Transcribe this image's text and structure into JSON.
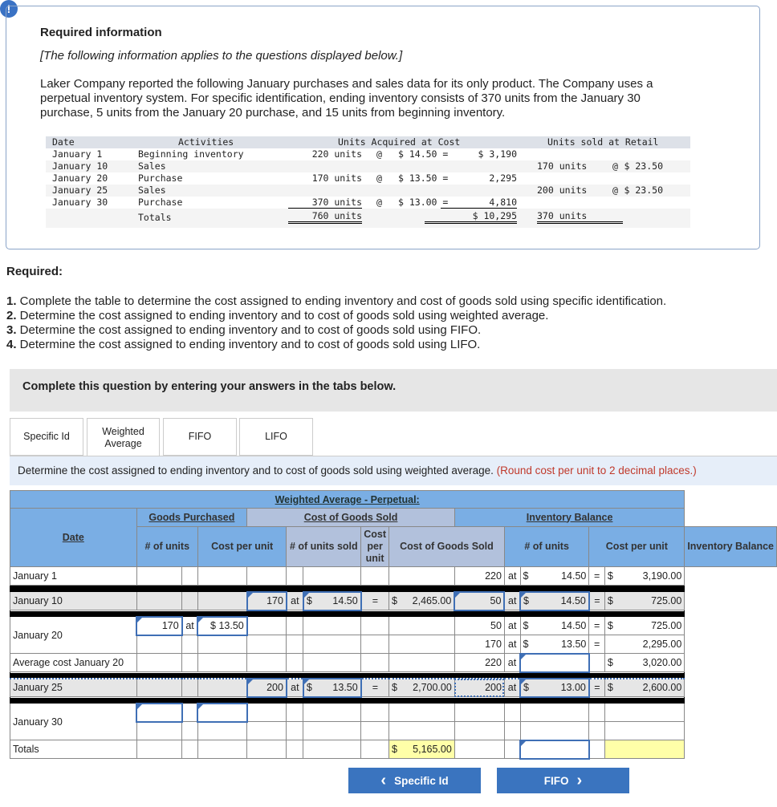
{
  "alert_icon": "!",
  "info": {
    "title": "Required information",
    "subtitle": "[The following information applies to the questions displayed below.]",
    "intro": "Laker Company reported the following January purchases and sales data for its only product. The Company uses a perpetual inventory system. For specific identification, ending inventory consists of 370 units from the January 30 purchase, 5 units from the January 20 purchase, and 15 units from beginning inventory.",
    "table": {
      "headers": {
        "date": "Date",
        "activities": "Activities",
        "acquired": "Units Acquired at Cost",
        "sold": "Units sold at Retail"
      },
      "rows": [
        {
          "date": "January 1",
          "activity": "Beginning inventory",
          "acq_units": "220 units",
          "acq_at": "@",
          "acq_cost": "$ 14.50 =",
          "acq_total": "$ 3,190",
          "sold_units": "",
          "sold_at": "",
          "sold_price": ""
        },
        {
          "date": "January 10",
          "activity": "Sales",
          "acq_units": "",
          "acq_at": "",
          "acq_cost": "",
          "acq_total": "",
          "sold_units": "170 units",
          "sold_at": "@",
          "sold_price": "$ 23.50"
        },
        {
          "date": "January 20",
          "activity": "Purchase",
          "acq_units": "170 units",
          "acq_at": "@",
          "acq_cost": "$ 13.50 =",
          "acq_total": "2,295",
          "sold_units": "",
          "sold_at": "",
          "sold_price": ""
        },
        {
          "date": "January 25",
          "activity": "Sales",
          "acq_units": "",
          "acq_at": "",
          "acq_cost": "",
          "acq_total": "",
          "sold_units": "200 units",
          "sold_at": "@",
          "sold_price": "$ 23.50"
        },
        {
          "date": "January 30",
          "activity": "Purchase",
          "acq_units": "370 units",
          "acq_at": "@",
          "acq_cost": "$ 13.00 =",
          "acq_total": "4,810",
          "sold_units": "",
          "sold_at": "",
          "sold_price": ""
        }
      ],
      "totals": {
        "label": "Totals",
        "acq_units": "760 units",
        "acq_total": "$ 10,295",
        "sold_units": "370 units"
      }
    }
  },
  "required": {
    "title": "Required:",
    "items": [
      {
        "num": "1.",
        "text": " Complete the table to determine the cost assigned to ending inventory and cost of goods sold using specific identification."
      },
      {
        "num": "2.",
        "text": " Determine the cost assigned to ending inventory and to cost of goods sold using weighted average."
      },
      {
        "num": "3.",
        "text": " Determine the cost assigned to ending inventory and to cost of goods sold using FIFO."
      },
      {
        "num": "4.",
        "text": " Determine the cost assigned to ending inventory and to cost of goods sold using LIFO."
      }
    ]
  },
  "band_text": "Complete this question by entering your answers in the tabs below.",
  "tabs": [
    {
      "label": "Specific Id"
    },
    {
      "label": "Weighted Average",
      "active": true
    },
    {
      "label": "FIFO"
    },
    {
      "label": "LIFO"
    }
  ],
  "instruction": {
    "text": "Determine the cost assigned to ending inventory and to cost of goods sold using weighted average. ",
    "note": "(Round cost per unit to 2 decimal places.)"
  },
  "worksheet": {
    "title": "Weighted Average - Perpetual:",
    "groups": {
      "purchased": "Goods Purchased",
      "cogs": "Cost of Goods Sold",
      "inventory": "Inventory Balance"
    },
    "columns": {
      "date": "Date",
      "gp_units": "# of units",
      "gp_cost": "Cost per unit",
      "sold_units": "# of units sold",
      "sold_cost": "Cost per unit",
      "cogs": "Cost of Goods Sold",
      "inv_units": "# of units",
      "inv_cost": "Cost per unit",
      "inv_bal": "Inventory Balance"
    },
    "at_label": "at",
    "eq_label": "=",
    "rows": [
      {
        "date": "January 1",
        "inv_units": "220",
        "inv_cost": "$ 14.50",
        "inv_bal": "$ 3,190.00"
      },
      {
        "date": "January 10",
        "sold_units": "170",
        "sold_cost": "$ 14.50",
        "cogs": "$ 2,465.00",
        "inv_units": "50",
        "inv_cost": "$ 14.50",
        "inv_bal": "$ 725.00"
      },
      {
        "date": "January 20",
        "gp_units": "170",
        "gp_cost": "$ 13.50",
        "inv_units": "50",
        "inv_cost": "$ 14.50",
        "inv_bal": "$ 725.00"
      },
      {
        "inv_units": "170",
        "inv_cost": "$ 13.50",
        "inv_bal": "2,295.00"
      },
      {
        "date": "Average cost January 20",
        "inv_units": "220",
        "inv_cost": "",
        "inv_bal": "$ 3,020.00"
      },
      {
        "date": "January 25",
        "sold_units": "200",
        "sold_cost": "$ 13.50",
        "cogs": "$ 2,700.00",
        "inv_units": "200",
        "inv_cost": "$ 13.00",
        "inv_bal": "$ 2,600.00"
      },
      {
        "date": "January 30",
        "gp_units": "",
        "gp_cost": ""
      },
      {},
      {
        "date": "Totals",
        "cogs": "$ 5,165.00",
        "inv_cost": ""
      }
    ]
  },
  "nav": {
    "prev": "Specific Id",
    "next": "FIFO",
    "prev_icon": "‹",
    "next_icon": "›"
  },
  "colors": {
    "accent": "#3a74bf",
    "header_blue": "#7aaee4",
    "header_gray": "#b2c1dc",
    "highlight": "#ffffa8",
    "note_red": "#c0392b"
  }
}
